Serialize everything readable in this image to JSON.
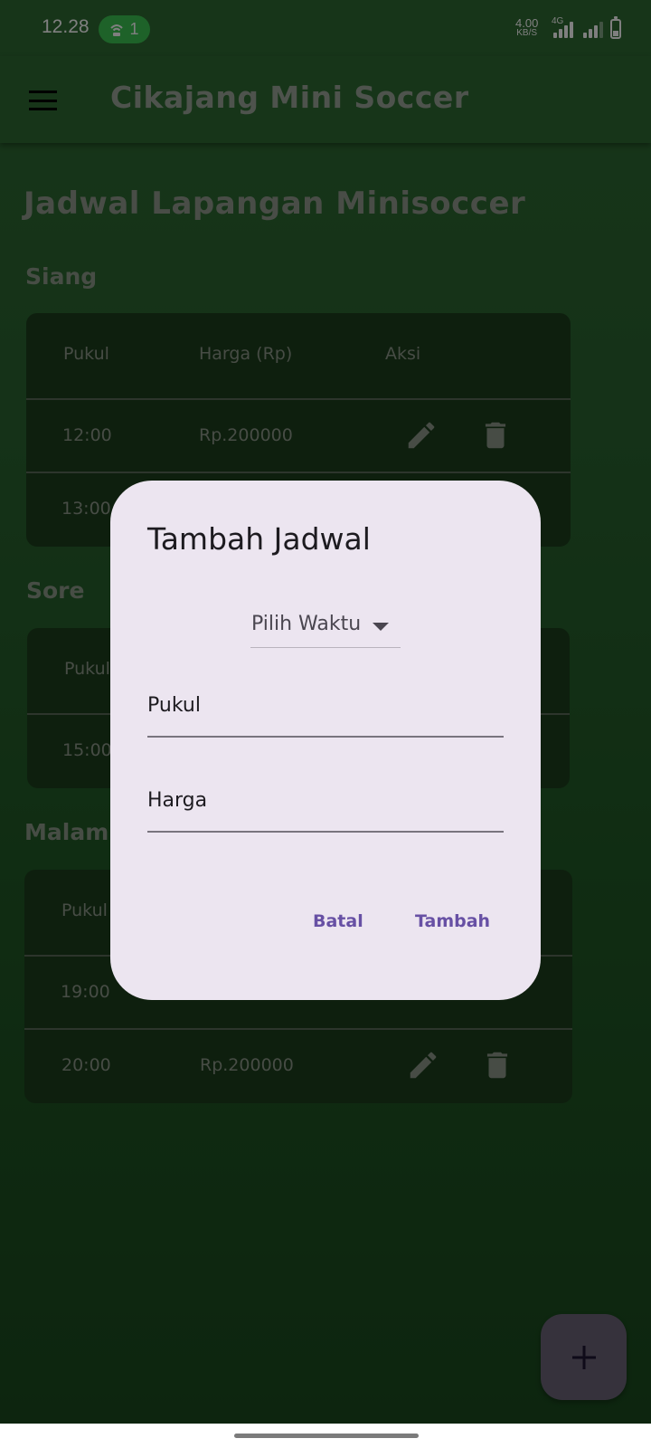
{
  "status_bar": {
    "time": "12.28",
    "hotspot_count": "1",
    "net_speed": "4.00",
    "net_speed_unit": "KB/S",
    "net_type": "4G"
  },
  "app_bar": {
    "title": "Cikajang Mini Soccer",
    "menu_icon": "hamburger-menu-icon"
  },
  "page": {
    "title": "Jadwal Lapangan Minisoccer",
    "headers": {
      "time": "Pukul",
      "price": "Harga (Rp)",
      "action": "Aksi"
    },
    "sections": [
      {
        "name": "Siang",
        "rows": [
          {
            "time": "12:00",
            "price": "Rp.200000"
          },
          {
            "time": "13:00",
            "price": ""
          }
        ]
      },
      {
        "name": "Sore",
        "rows": [
          {
            "time": "15:00",
            "price": ""
          }
        ]
      },
      {
        "name": "Malam",
        "rows": [
          {
            "time": "19:00",
            "price": ""
          },
          {
            "time": "20:00",
            "price": "Rp.200000"
          }
        ]
      }
    ]
  },
  "dialog": {
    "title": "Tambah Jadwal",
    "dropdown_label": "Pilih Waktu",
    "time_placeholder": "Pukul",
    "price_placeholder": "Harga",
    "cancel_label": "Batal",
    "confirm_label": "Tambah"
  },
  "fab": {
    "icon": "plus-icon"
  },
  "colors": {
    "background": "#2f6b33",
    "card": "#1c3f1d",
    "dialog": "#ece5f0",
    "accent": "#6750a4",
    "fab": "#6d6479"
  }
}
